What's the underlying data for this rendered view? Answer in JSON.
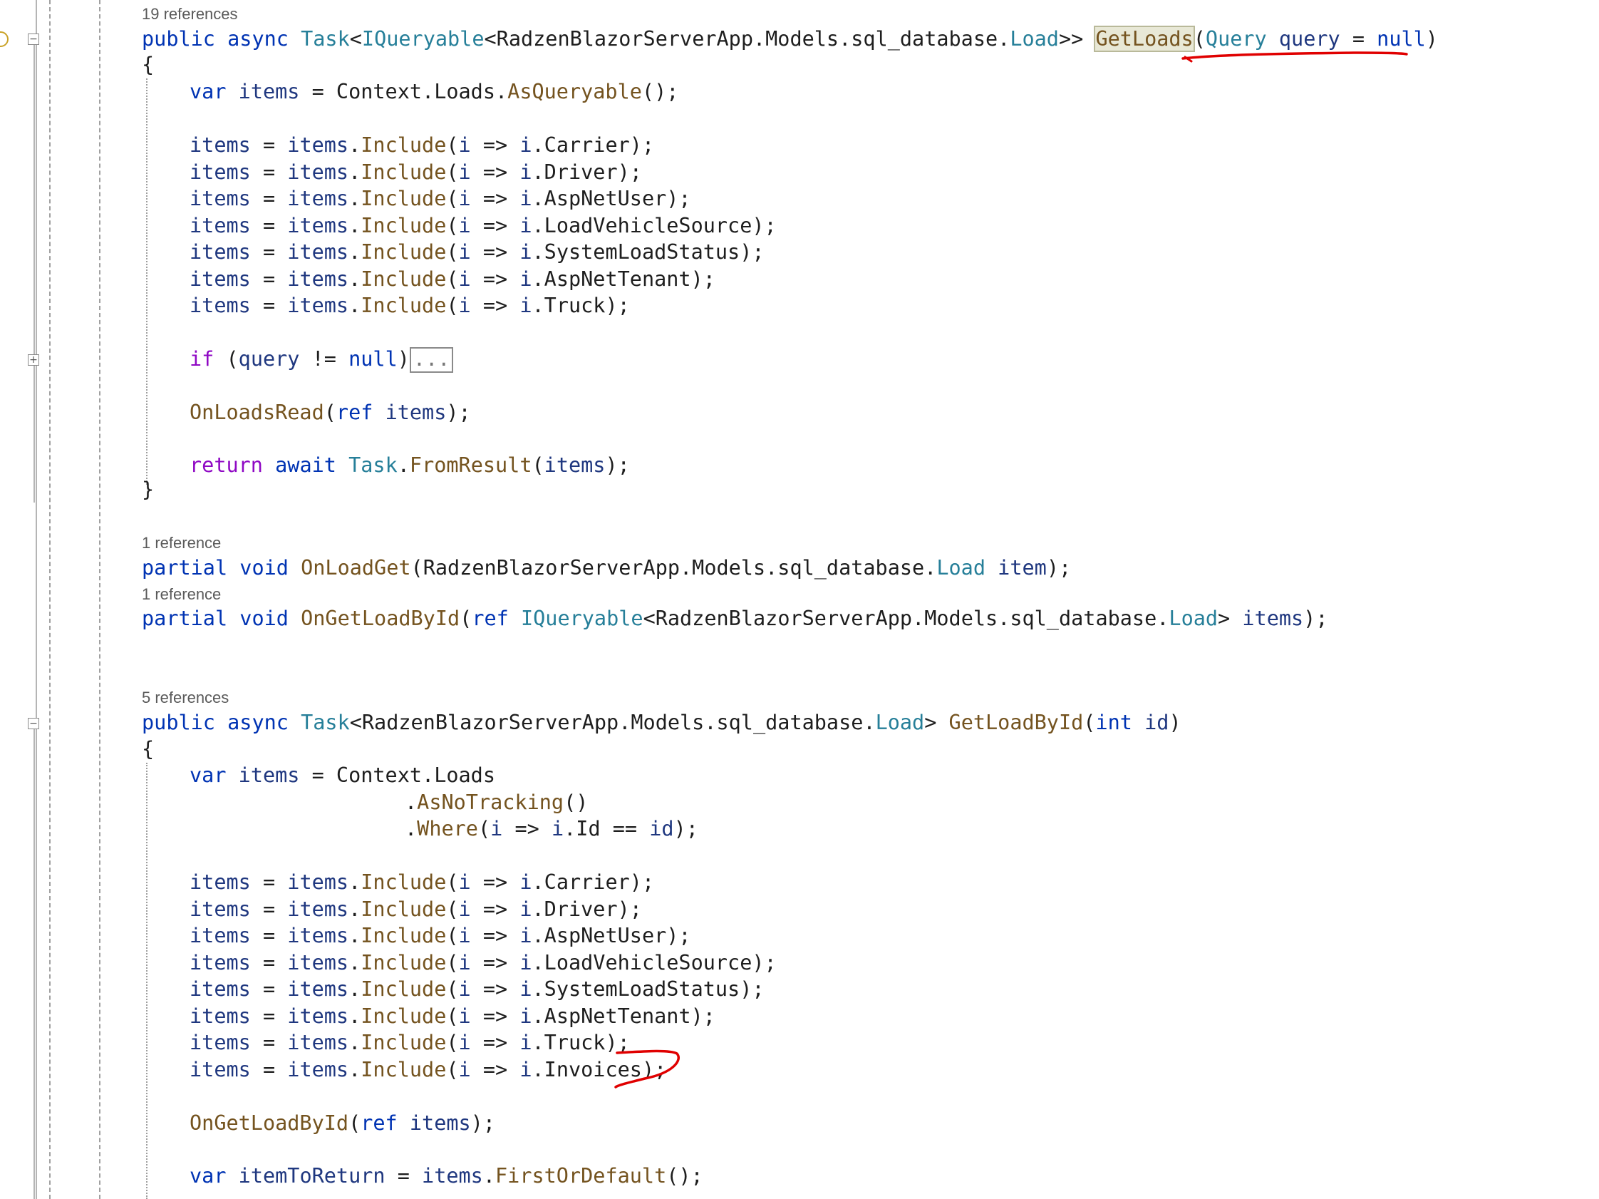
{
  "method1": {
    "refs": "19 references",
    "sig": {
      "p1": "public",
      "p2": " ",
      "p3": "async",
      "p4": " ",
      "p5": "Task",
      "p6": "<",
      "p7": "IQueryable",
      "p8": "<RadzenBlazorServerApp.Models.sql_database.",
      "p9": "Load",
      "p10": ">> ",
      "p11": "GetLoads",
      "p12": "(",
      "p13": "Query",
      "p14": " ",
      "p15": "query",
      "p16": " = ",
      "p17": "null",
      "p18": ")"
    },
    "open": "{",
    "var_line": {
      "p1": "var",
      "p2": " ",
      "p3": "items",
      "p4": " = Context.Loads.",
      "p5": "AsQueryable",
      "p6": "();"
    },
    "includes": [
      {
        "a": "items",
        "b": " = ",
        "c": "items",
        "d": ".",
        "e": "Include",
        "f": "(",
        "g": "i",
        "h": " => ",
        "i": "i",
        "j": ".Carrier);"
      },
      {
        "a": "items",
        "b": " = ",
        "c": "items",
        "d": ".",
        "e": "Include",
        "f": "(",
        "g": "i",
        "h": " => ",
        "i": "i",
        "j": ".Driver);"
      },
      {
        "a": "items",
        "b": " = ",
        "c": "items",
        "d": ".",
        "e": "Include",
        "f": "(",
        "g": "i",
        "h": " => ",
        "i": "i",
        "j": ".AspNetUser);"
      },
      {
        "a": "items",
        "b": " = ",
        "c": "items",
        "d": ".",
        "e": "Include",
        "f": "(",
        "g": "i",
        "h": " => ",
        "i": "i",
        "j": ".LoadVehicleSource);"
      },
      {
        "a": "items",
        "b": " = ",
        "c": "items",
        "d": ".",
        "e": "Include",
        "f": "(",
        "g": "i",
        "h": " => ",
        "i": "i",
        "j": ".SystemLoadStatus);"
      },
      {
        "a": "items",
        "b": " = ",
        "c": "items",
        "d": ".",
        "e": "Include",
        "f": "(",
        "g": "i",
        "h": " => ",
        "i": "i",
        "j": ".AspNetTenant);"
      },
      {
        "a": "items",
        "b": " = ",
        "c": "items",
        "d": ".",
        "e": "Include",
        "f": "(",
        "g": "i",
        "h": " => ",
        "i": "i",
        "j": ".Truck);"
      }
    ],
    "if_line": {
      "p1": "if",
      "p2": " (",
      "p3": "query",
      "p4": " != ",
      "p5": "null",
      "p6": ")",
      "collapsed": "..."
    },
    "onread": {
      "p1": "OnLoadsRead",
      "p2": "(",
      "p3": "ref",
      "p4": " ",
      "p5": "items",
      "p6": ");"
    },
    "ret": {
      "p1": "return",
      "p2": " ",
      "p3": "await",
      "p4": " ",
      "p5": "Task",
      "p6": ".",
      "p7": "FromResult",
      "p8": "(",
      "p9": "items",
      "p10": ");"
    },
    "close": "}"
  },
  "partial1": {
    "refs": "1 reference",
    "p1": "partial",
    "p2": " ",
    "p3": "void",
    "p4": " ",
    "p5": "OnLoadGet",
    "p6": "(RadzenBlazorServerApp.Models.sql_database.",
    "p7": "Load",
    "p8": " ",
    "p9": "item",
    "p10": ");"
  },
  "partial2": {
    "refs": "1 reference",
    "p1": "partial",
    "p2": " ",
    "p3": "void",
    "p4": " ",
    "p5": "OnGetLoadById",
    "p6": "(",
    "p7": "ref",
    "p8": " ",
    "p9": "IQueryable",
    "p10": "<RadzenBlazorServerApp.Models.sql_database.",
    "p11": "Load",
    "p12": "> ",
    "p13": "items",
    "p14": ");"
  },
  "method2": {
    "refs": "5 references",
    "sig": {
      "p1": "public",
      "p2": " ",
      "p3": "async",
      "p4": " ",
      "p5": "Task",
      "p6": "<RadzenBlazorServerApp.Models.sql_database.",
      "p7": "Load",
      "p8": "> ",
      "p9": "GetLoadById",
      "p10": "(",
      "p11": "int",
      "p12": " ",
      "p13": "id",
      "p14": ")"
    },
    "open": "{",
    "var_line": {
      "p1": "var",
      "p2": " ",
      "p3": "items",
      "p4": " = Context.Loads"
    },
    "no_tracking": {
      "p1": ".",
      "p2": "AsNoTracking",
      "p3": "()"
    },
    "where": {
      "p1": ".",
      "p2": "Where",
      "p3": "(",
      "p4": "i",
      "p5": " => ",
      "p6": "i",
      "p7": ".Id == ",
      "p8": "id",
      "p9": ");"
    },
    "includes": [
      {
        "a": "items",
        "b": " = ",
        "c": "items",
        "d": ".",
        "e": "Include",
        "f": "(",
        "g": "i",
        "h": " => ",
        "i": "i",
        "j": ".Carrier);"
      },
      {
        "a": "items",
        "b": " = ",
        "c": "items",
        "d": ".",
        "e": "Include",
        "f": "(",
        "g": "i",
        "h": " => ",
        "i": "i",
        "j": ".Driver);"
      },
      {
        "a": "items",
        "b": " = ",
        "c": "items",
        "d": ".",
        "e": "Include",
        "f": "(",
        "g": "i",
        "h": " => ",
        "i": "i",
        "j": ".AspNetUser);"
      },
      {
        "a": "items",
        "b": " = ",
        "c": "items",
        "d": ".",
        "e": "Include",
        "f": "(",
        "g": "i",
        "h": " => ",
        "i": "i",
        "j": ".LoadVehicleSource);"
      },
      {
        "a": "items",
        "b": " = ",
        "c": "items",
        "d": ".",
        "e": "Include",
        "f": "(",
        "g": "i",
        "h": " => ",
        "i": "i",
        "j": ".SystemLoadStatus);"
      },
      {
        "a": "items",
        "b": " = ",
        "c": "items",
        "d": ".",
        "e": "Include",
        "f": "(",
        "g": "i",
        "h": " => ",
        "i": "i",
        "j": ".AspNetTenant);"
      },
      {
        "a": "items",
        "b": " = ",
        "c": "items",
        "d": ".",
        "e": "Include",
        "f": "(",
        "g": "i",
        "h": " => ",
        "i": "i",
        "j": ".Truck);"
      },
      {
        "a": "items",
        "b": " = ",
        "c": "items",
        "d": ".",
        "e": "Include",
        "f": "(",
        "g": "i",
        "h": " => ",
        "i": "i",
        "j": ".Invoices);"
      }
    ],
    "onget": {
      "p1": "OnGetLoadById",
      "p2": "(",
      "p3": "ref",
      "p4": " ",
      "p5": "items",
      "p6": ");"
    },
    "toreturn": {
      "p1": "var",
      "p2": " ",
      "p3": "itemToReturn",
      "p4": " = ",
      "p5": "items",
      "p6": ".",
      "p7": "FirstOrDefault",
      "p8": "();"
    }
  },
  "colors": {
    "keyword": "#0033b3",
    "control": "#8f08c4",
    "type": "#267f99",
    "method": "#74531f",
    "identifier": "#1f377f",
    "annotation": "#e00000"
  }
}
